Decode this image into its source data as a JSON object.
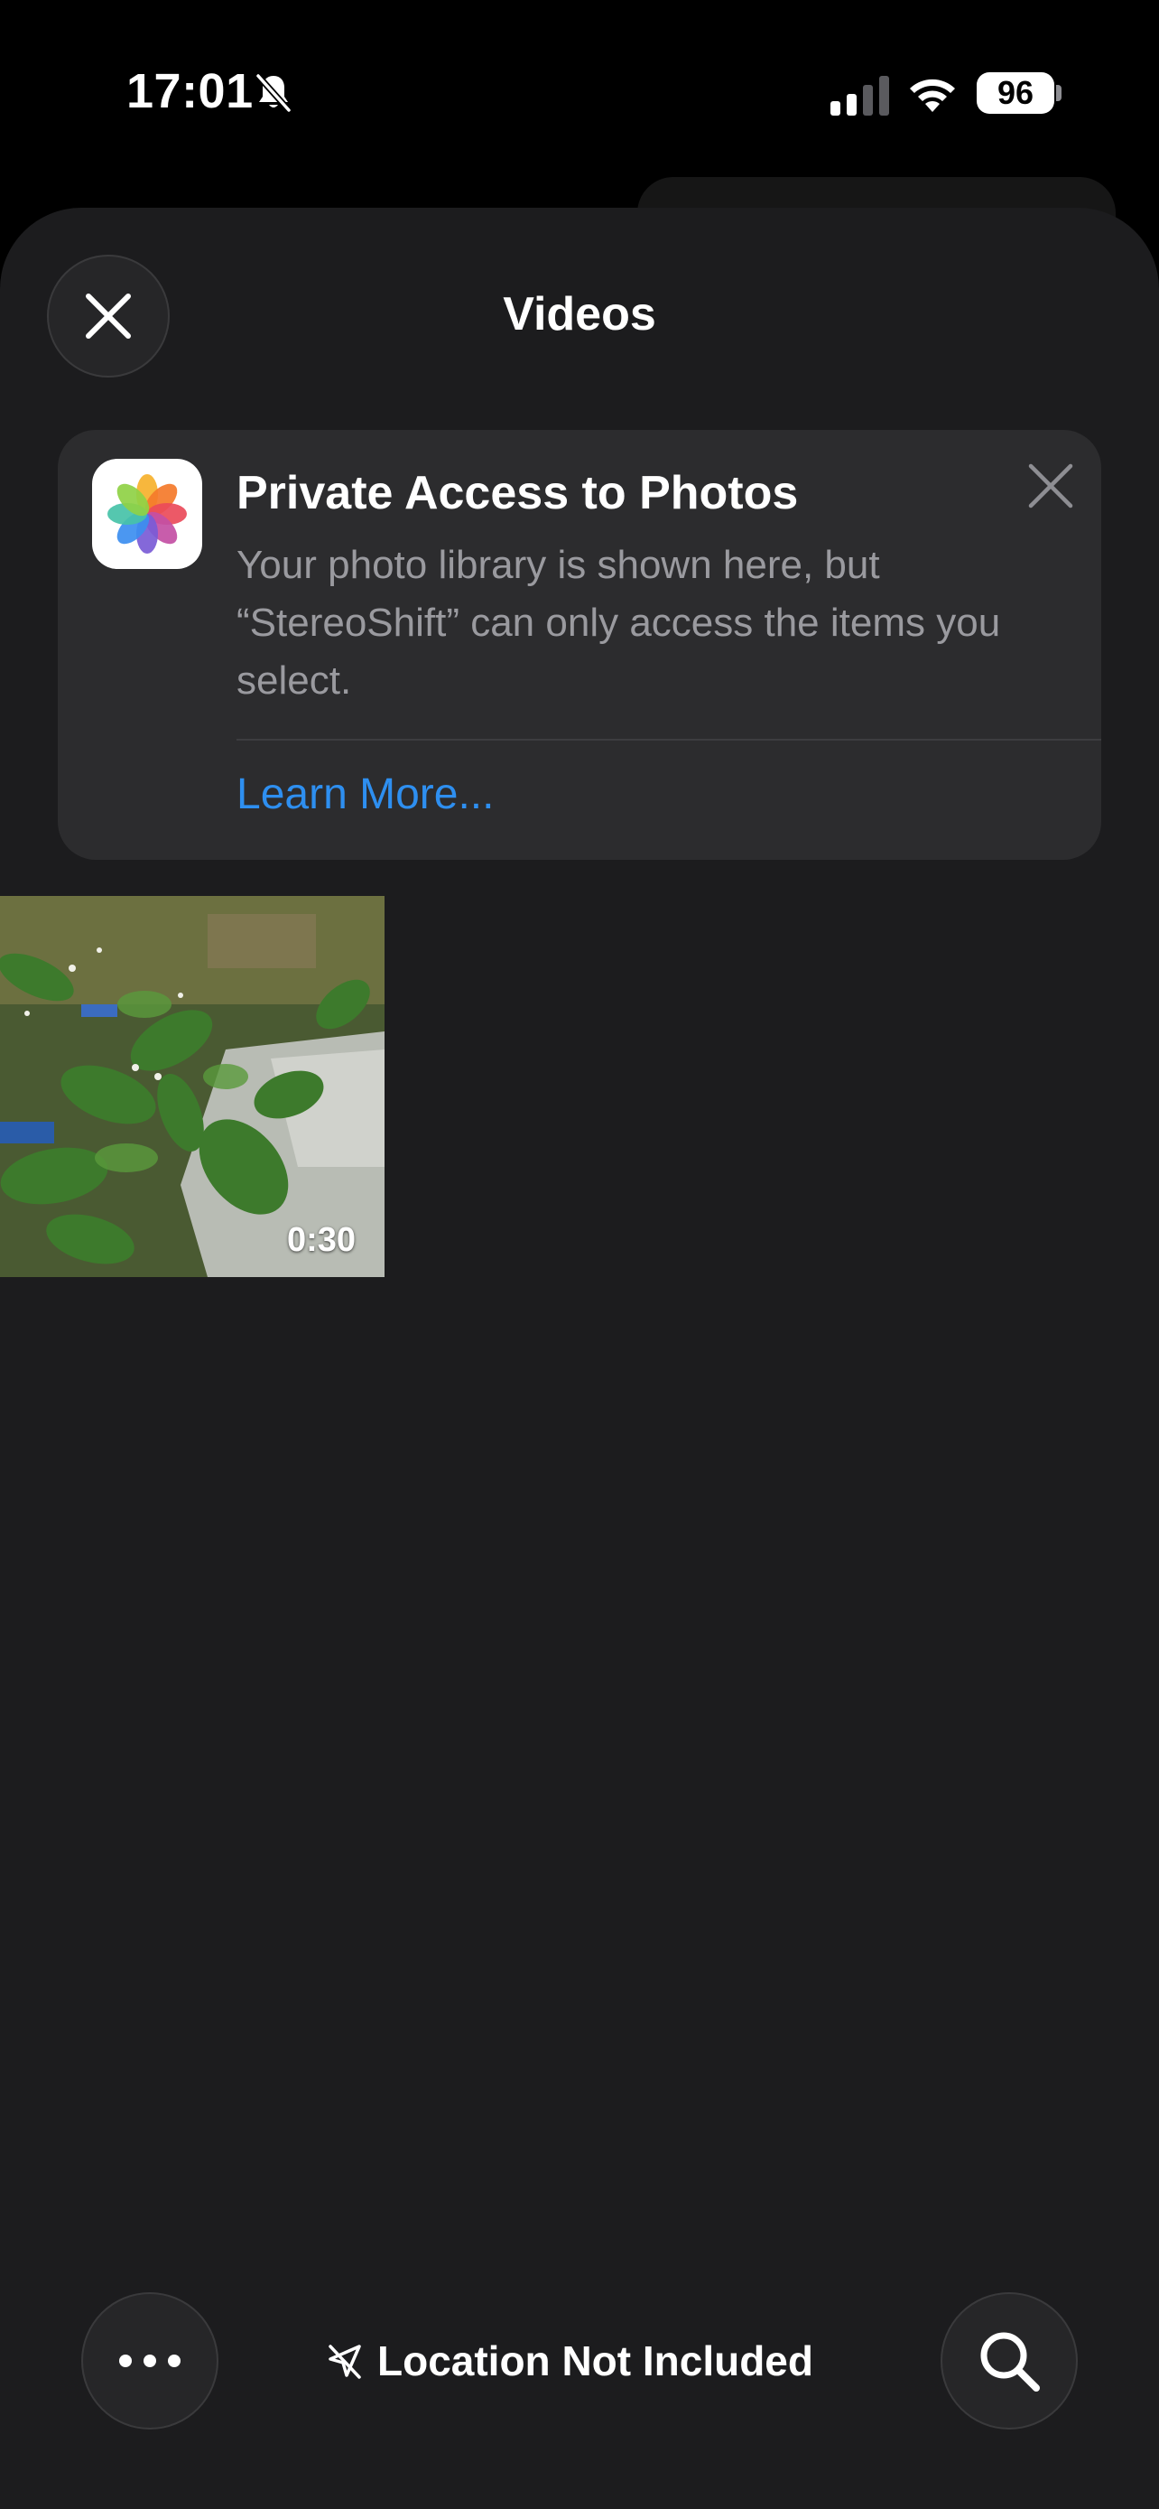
{
  "status_bar": {
    "time": "17:01",
    "battery": "96",
    "icons": [
      "bell-slash-icon",
      "cellular-signal-icon",
      "wifi-icon",
      "battery-icon"
    ]
  },
  "header": {
    "title": "Videos",
    "close_icon": "close-icon"
  },
  "privacy_card": {
    "title": "Private Access to Photos",
    "body": "Your photo library is shown here, but “StereoShift” can only access the items you select.",
    "link": "Learn More...",
    "app_icon": "photos-app-icon",
    "dismiss_icon": "close-icon",
    "link_color": "#2e8ff0"
  },
  "videos": [
    {
      "duration": "0:30",
      "thumbnail": "plant-leaves-video-thumbnail"
    }
  ],
  "bottom_bar": {
    "more_icon": "ellipsis-icon",
    "location_label": "Location Not Included",
    "location_icon": "location-slash-icon",
    "search_icon": "search-icon"
  },
  "colors": {
    "sheet_background": "#1c1c1e",
    "card_background": "#2c2c2e",
    "secondary_text": "#9a9a9f"
  }
}
